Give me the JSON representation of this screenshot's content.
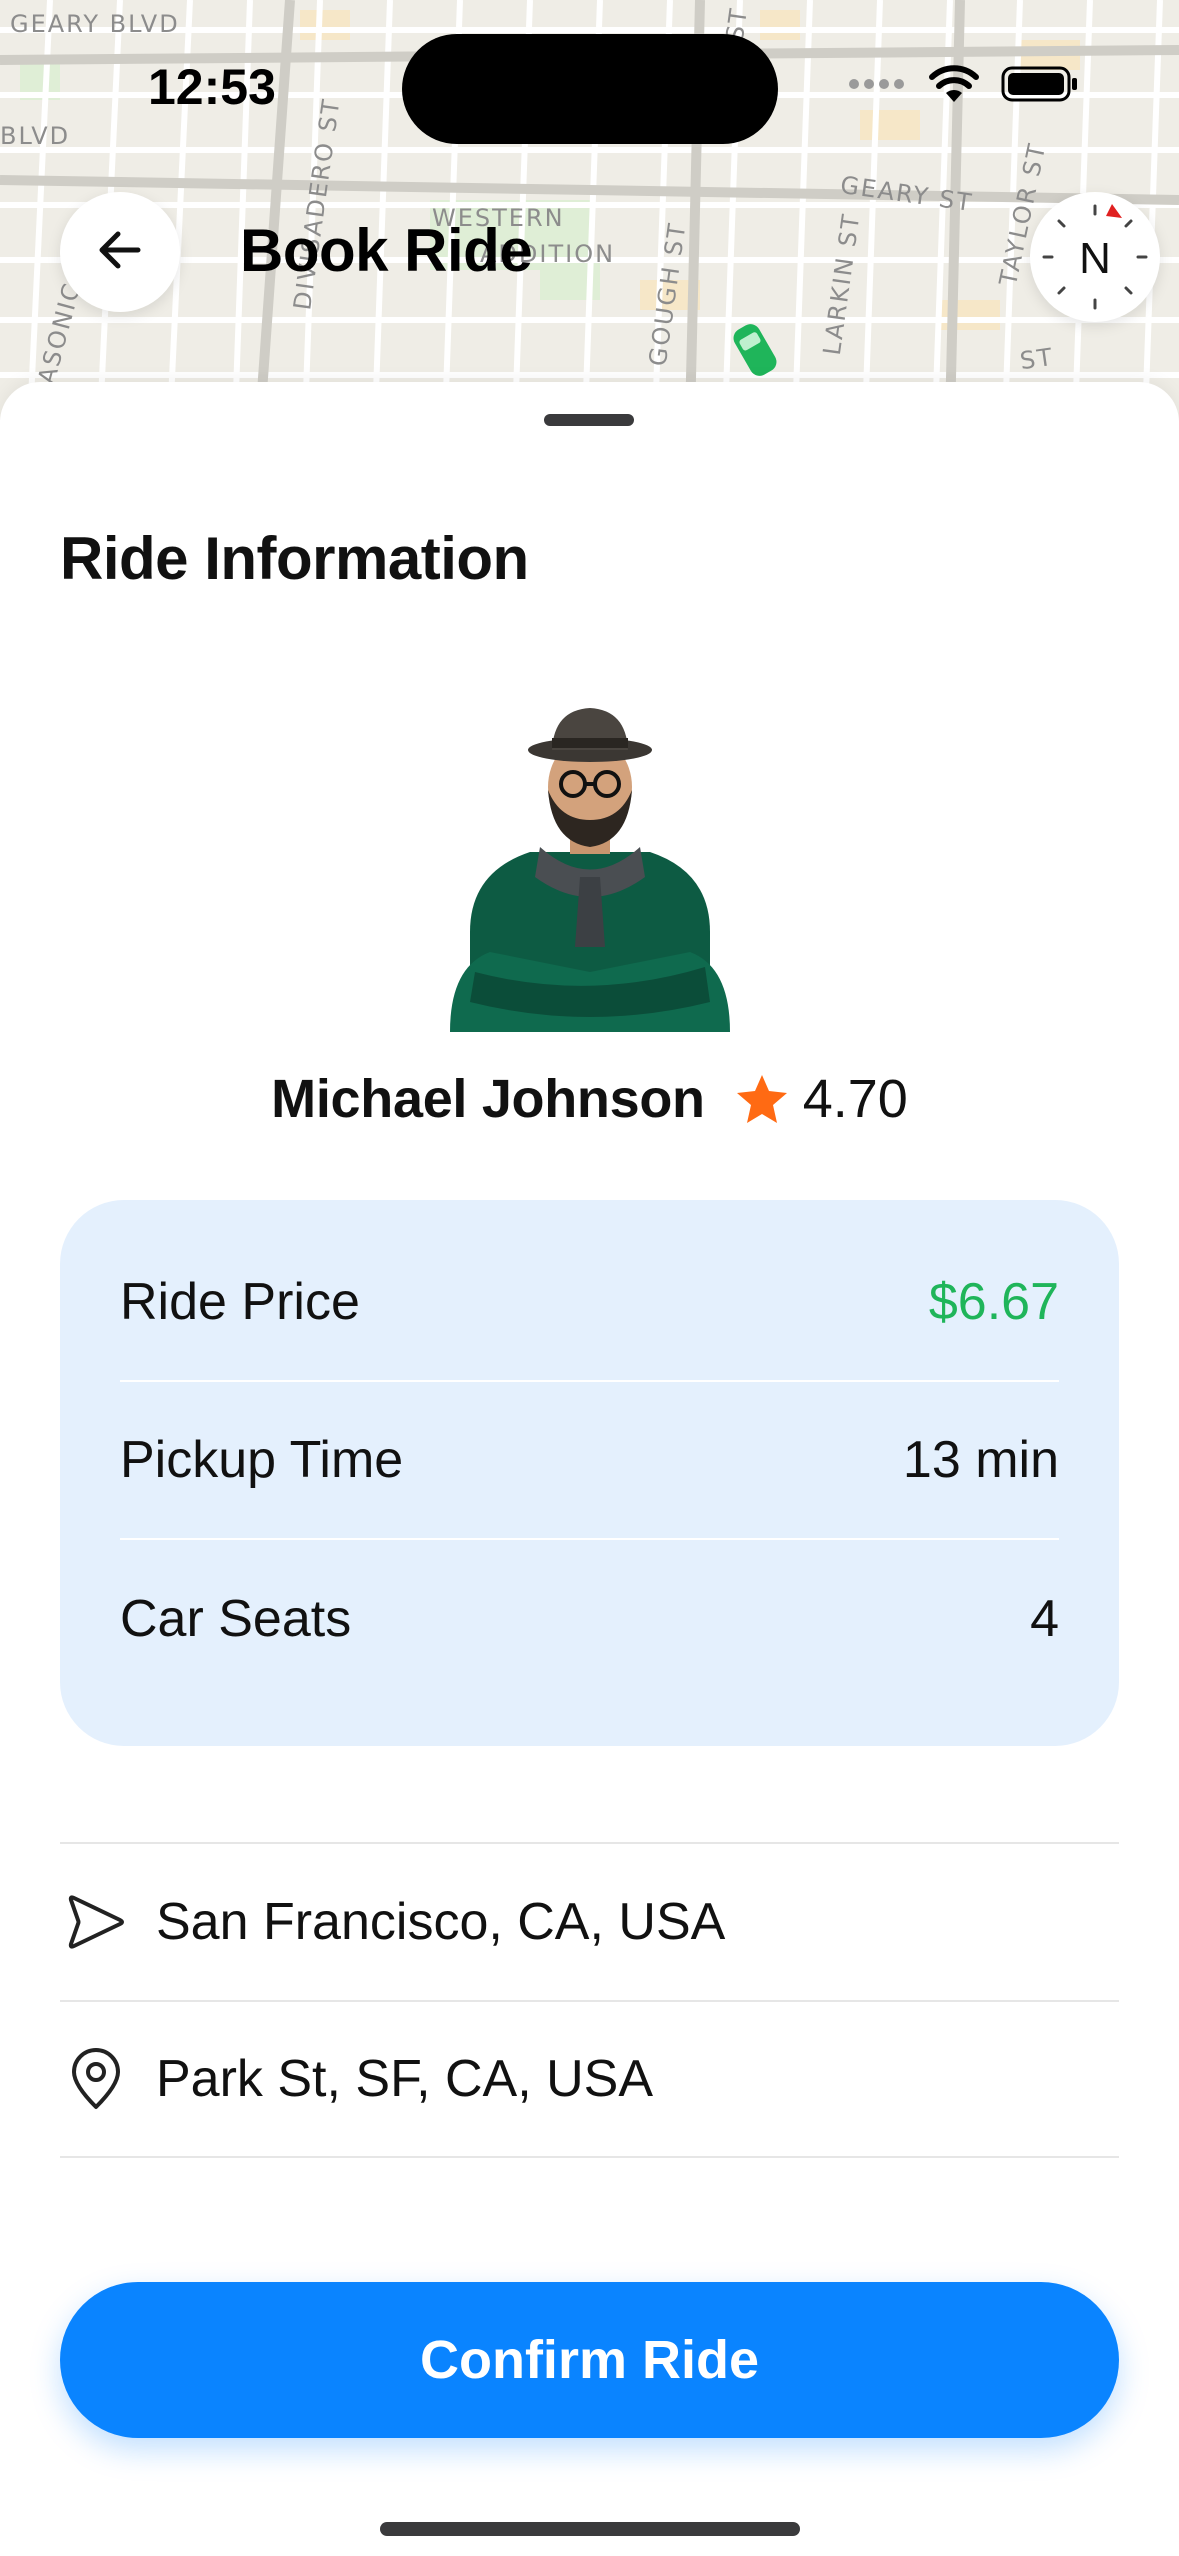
{
  "status_bar": {
    "time": "12:53"
  },
  "header": {
    "title": "Book Ride",
    "compass_label": "N"
  },
  "map": {
    "labels": [
      "GEARY BLVD",
      "BLVD",
      "MASONIC AVE",
      "DIVISADERO ST",
      "WESTERN",
      "ADDITION",
      "GOUGH ST",
      "LARKIN ST",
      "GEARY ST",
      "TAYLOR ST",
      "ST",
      "ST"
    ]
  },
  "sheet": {
    "section_title": "Ride Information",
    "driver": {
      "name": "Michael Johnson",
      "rating": "4.70"
    },
    "info": [
      {
        "label": "Ride Price",
        "value": "$6.67"
      },
      {
        "label": "Pickup Time",
        "value": "13 min"
      },
      {
        "label": "Car Seats",
        "value": "4"
      }
    ],
    "locations": [
      {
        "icon": "navigation-arrow-icon",
        "text": "San Francisco, CA, USA"
      },
      {
        "icon": "map-pin-icon",
        "text": "Park St, SF, CA, USA"
      }
    ],
    "confirm_label": "Confirm Ride"
  },
  "colors": {
    "accent": "#0a84ff",
    "price": "#1fb55a",
    "card_bg": "#e4f0fd",
    "star": "#ff6a13"
  }
}
